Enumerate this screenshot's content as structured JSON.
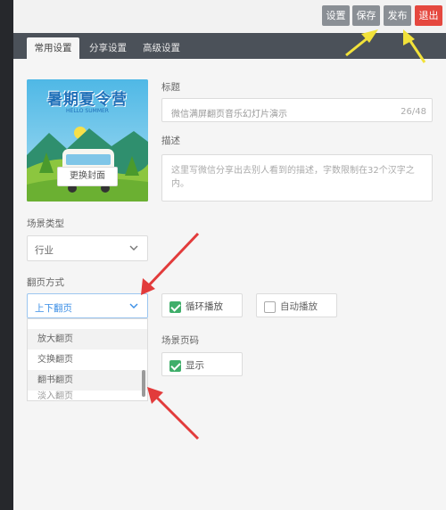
{
  "topbar": {
    "settings_label": "设置",
    "save_label": "保存",
    "publish_label": "发布",
    "exit_label": "退出"
  },
  "tabs": [
    {
      "label": "常用设置"
    },
    {
      "label": "分享设置"
    },
    {
      "label": "高级设置"
    }
  ],
  "cover": {
    "change_label": "更换封面",
    "logo_text": "暑期夏令营",
    "logo_sub": "HELLO SUMMER"
  },
  "title_field": {
    "label": "标题",
    "value": "微信满屏翻页音乐幻灯片演示",
    "counter": "26/48"
  },
  "desc_field": {
    "label": "描述",
    "placeholder": "这里写微信分享出去别人看到的描述，字数限制在32个汉字之内。"
  },
  "scene_type": {
    "label": "场景类型",
    "value": "行业"
  },
  "page_flip": {
    "label": "翻页方式",
    "value": "上下翻页",
    "options": [
      "放大翻页",
      "交换翻页",
      "翻书翻页",
      "淡入翻页"
    ]
  },
  "loop": {
    "label": "循环播放",
    "checked": true
  },
  "autoplay": {
    "label": "自动播放",
    "checked": false
  },
  "scene_page": {
    "label": "场景页码"
  },
  "show_page": {
    "label": "显示",
    "checked": true
  },
  "colors": {
    "accent": "#3fae6a",
    "link": "#3a8ee6",
    "exit": "#e5483f",
    "tabs_bg": "#4b5159",
    "arrow_red": "#e23b3b",
    "arrow_yellow": "#f2e23a"
  }
}
